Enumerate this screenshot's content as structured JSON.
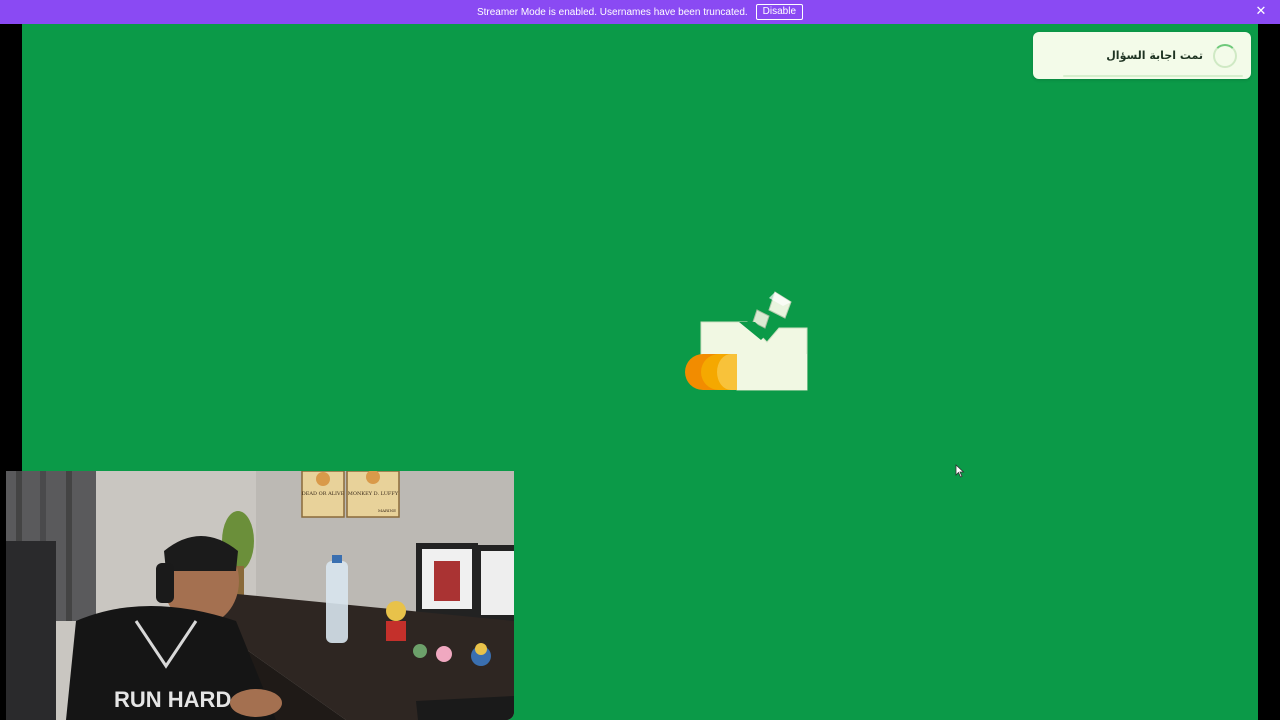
{
  "banner": {
    "message": "Streamer Mode is enabled. Usernames have been truncated.",
    "disable_label": "Disable",
    "close_icon": "close-icon",
    "background": "#8a4af3"
  },
  "stage": {
    "background": "#0b9a48"
  },
  "toast": {
    "text": "تمت اجابة السؤال",
    "icon": "loading-spinner-icon"
  },
  "logo": {
    "icon": "folder-arrow-logo",
    "colors": [
      "#f0f8e0",
      "#f28c00",
      "#f5a800"
    ]
  },
  "webcam": {
    "posters": [
      "DEAD OR ALIVE",
      "MONKEY D. LUFFY",
      "MARINE"
    ],
    "shirt_text": "RUN HARD"
  }
}
